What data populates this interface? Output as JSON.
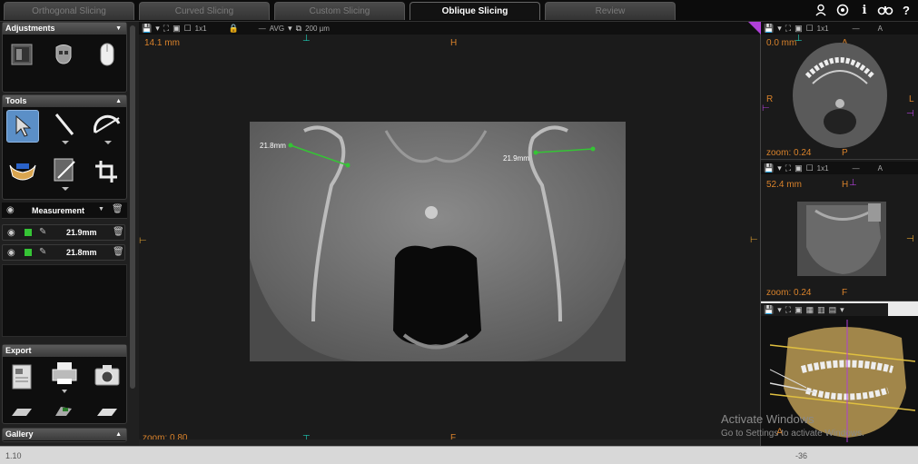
{
  "tabs": [
    {
      "label": "Orthogonal Slicing",
      "active": false
    },
    {
      "label": "Curved Slicing",
      "active": false
    },
    {
      "label": "Custom Slicing",
      "active": false
    },
    {
      "label": "Oblique Slicing",
      "active": true
    },
    {
      "label": "Review",
      "active": false
    }
  ],
  "top_icons": [
    "person-icon",
    "target-icon",
    "info-icon",
    "keys-icon",
    "help-icon"
  ],
  "top_icon_glyphs": {
    "info": "i",
    "help": "?"
  },
  "adjustments": {
    "title": "Adjustments"
  },
  "tools": {
    "title": "Tools"
  },
  "measurement": {
    "header": "Measurement",
    "rows": [
      {
        "value": "21.9mm"
      },
      {
        "value": "21.8mm"
      }
    ]
  },
  "export": {
    "title": "Export"
  },
  "gallery": {
    "title": "Gallery"
  },
  "main_view": {
    "toolbar_layout": "1x1",
    "toolbar_mode": "AVG",
    "toolbar_thickness": "200 µm",
    "slice_depth": "14.1 mm",
    "top_label": "H",
    "bottom_label": "F",
    "zoom": "zoom: 0.80",
    "measure_left": "21.8mm",
    "measure_right": "21.9mm"
  },
  "axial_view": {
    "toolbar_layout": "1x1",
    "toolbar_axis": "A",
    "depth": "0.0 mm",
    "left_label": "R",
    "right_label": "L",
    "top_label": "A",
    "bottom_label": "P",
    "zoom": "zoom: 0.24"
  },
  "sagittal_view": {
    "toolbar_layout": "1x1",
    "toolbar_axis": "A",
    "depth": "52.4 mm",
    "top_label": "H",
    "bottom_label": "F",
    "zoom": "zoom: 0.24"
  },
  "render_view": {
    "bottom_label": "A"
  },
  "status": {
    "left": "1.10",
    "right": "-36"
  },
  "watermark": {
    "line1": "Activate Windows",
    "line2": "Go to Settings to activate Windows."
  },
  "colors": {
    "accent_orange": "#d9822b",
    "measure_green": "#35c435",
    "marker_teal": "#1ec9b4",
    "marker_purple": "#b040d8",
    "panel_bg": "#0e0e0e",
    "selected_tool": "#5b8fc7"
  }
}
